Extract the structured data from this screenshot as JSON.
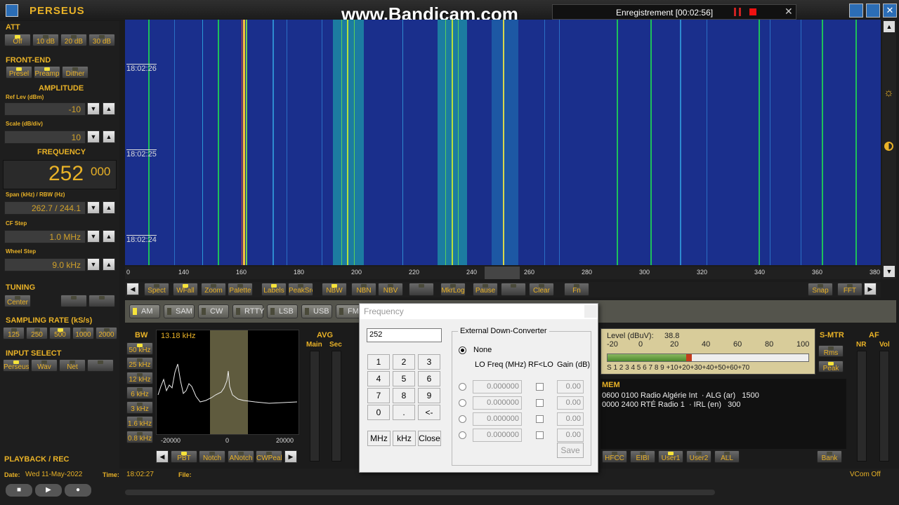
{
  "app": {
    "title": "PERSEUS"
  },
  "overlay": {
    "brand": "www.Bandicam.com",
    "recording": "Enregistrement [00:02:56]"
  },
  "left": {
    "att": {
      "label": "ATT",
      "buttons": [
        "Off",
        "10 dB",
        "20 dB",
        "30 dB"
      ]
    },
    "frontend": {
      "label": "FRONT-END",
      "buttons": [
        "Presel",
        "Preamp",
        "Dither"
      ]
    },
    "amplitude": {
      "label": "AMPLITUDE",
      "ref_label": "Ref Lev (dBm)",
      "ref_value": "-10",
      "scale_label": "Scale (dB/div)",
      "scale_value": "10"
    },
    "frequency": {
      "label": "FREQUENCY",
      "main": "252",
      "sub": "000",
      "span_label": "Span (kHz) / RBW (Hz)",
      "span_value": "262.7 / 244.1",
      "cf_label": "CF Step",
      "cf_value": "1.0 MHz",
      "wheel_label": "Wheel Step",
      "wheel_value": "9.0 kHz"
    },
    "tuning": {
      "label": "TUNING",
      "buttons": [
        "Center",
        "",
        ""
      ]
    },
    "sampling": {
      "label": "SAMPLING RATE (kS/s)",
      "buttons": [
        "125",
        "250",
        "500",
        "1000",
        "2000"
      ]
    },
    "input": {
      "label": "INPUT SELECT",
      "buttons": [
        "Perseus",
        "Wav",
        "Net",
        ""
      ]
    },
    "playback": {
      "label": "PLAYBACK / REC"
    }
  },
  "waterfall": {
    "times": [
      "18:02:26",
      "18:02:25",
      "18:02:24"
    ],
    "axis": [
      "0",
      "140",
      "160",
      "180",
      "200",
      "220",
      "240",
      "260",
      "280",
      "300",
      "320",
      "340",
      "360",
      "380"
    ]
  },
  "toolbar": {
    "buttons": [
      "Spect",
      "WFall",
      "Zoom",
      "Palette",
      "Labels",
      "PeakSrc",
      "NBW",
      "NBN",
      "NBV",
      "",
      "MkrLog",
      "Pause",
      "",
      "Clear",
      "Fn",
      "Snap",
      "FFT"
    ]
  },
  "modes": [
    "AM",
    "SAM",
    "CW",
    "RTTY",
    "LSB",
    "USB",
    "FM"
  ],
  "bw": {
    "label": "BW",
    "buttons": [
      "50 kHz",
      "25 kHz",
      "12 kHz",
      "6 kHz",
      "3 kHz",
      "1.6 kHz",
      "0.8 kHz"
    ],
    "readout": "13.18 kHz",
    "axis": [
      "-20000",
      "0",
      "20000"
    ]
  },
  "bwbar": {
    "buttons": [
      "PBT",
      "Notch",
      "ANotch",
      "CWPeak"
    ]
  },
  "avg": {
    "label": "AVG",
    "main": "Main",
    "sec": "Sec"
  },
  "smeter": {
    "label": "S-MTR",
    "level_label": "Level (dBuV):",
    "level_value": "38.8",
    "top_scale": [
      "-20",
      "0",
      "20",
      "40",
      "60",
      "80",
      "100"
    ],
    "bottom_scale": "S 1 2 3 4 5 6 7 8 9 +10+20+30+40+50+60+70",
    "level_pct": 38.8,
    "rms": "Rms",
    "peak": "Peak"
  },
  "af": {
    "label": "AF",
    "nr": "NR",
    "vol": "Vol"
  },
  "mem": {
    "label": "MEM",
    "rows": [
      "0600 0100 Radio Algérie Int  · ALG (ar)   1500",
      "0000 2400 RTÉ Radio 1  · IRL (en)   300"
    ],
    "buttons": [
      "HFCC",
      "EIBI",
      "User1",
      "User2",
      "ALL",
      "Bank"
    ]
  },
  "status": {
    "date_label": "Date:",
    "date": "Wed 11-May-2022",
    "time_label": "Time:",
    "time": "18:02:27",
    "file_label": "File:",
    "vcom": "VCom Off"
  },
  "dialog": {
    "title": "Frequency",
    "input": "252",
    "keys": [
      "1",
      "2",
      "3",
      "4",
      "5",
      "6",
      "7",
      "8",
      "9",
      "0",
      ".",
      "<-"
    ],
    "units": [
      "MHz",
      "kHz",
      "Close"
    ],
    "group": "External Down-Converter",
    "none": "None",
    "col_lo": "LO Freq (MHz)",
    "col_rf": "RF<LO",
    "col_gain": "Gain (dB)",
    "rows": [
      {
        "lo": "0.000000",
        "gain": "0.00"
      },
      {
        "lo": "0.000000",
        "gain": "0.00"
      },
      {
        "lo": "0.000000",
        "gain": "0.00"
      },
      {
        "lo": "0.000000",
        "gain": "0.00"
      }
    ],
    "save": "Save"
  }
}
